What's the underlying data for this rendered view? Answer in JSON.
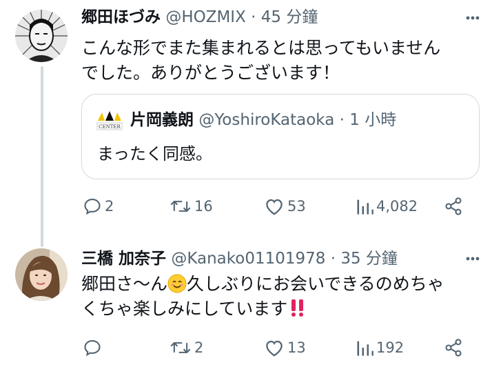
{
  "tweet1": {
    "name": "郷田ほづみ",
    "handle": "@HOZMIX",
    "time": " · 45 分鐘",
    "text_line1": "こんな形でまた集まれるとは思ってもいません",
    "text_line2": "でした。ありがとうございます！",
    "quote": {
      "name": "片岡義朗",
      "handle": "@YoshiroKataoka",
      "time": " · 1 小時",
      "avatar_text": "CENTER",
      "text": "まったく同感。"
    },
    "actions": {
      "replies": "2",
      "retweets": "16",
      "likes": "53",
      "views": "4,082"
    }
  },
  "tweet2": {
    "name": "三橋 加奈子",
    "handle": "@Kanako01101978",
    "time": " · 35 分鐘",
    "text_line1_a": "郷田さ〜ん",
    "emoji_1": "😊",
    "text_line1_b": "久しぶりにお会いできるのめちゃ",
    "text_line2": "くちゃ楽しみにしています",
    "emoji_2": "‼️",
    "actions": {
      "replies": "",
      "retweets": "2",
      "likes": "13",
      "views": "192"
    }
  },
  "icons": [
    "reply-icon",
    "retweet-icon",
    "like-icon",
    "views-icon",
    "share-icon",
    "more-icon"
  ],
  "colors": {
    "text": "#0f1419",
    "secondary": "#536471",
    "border": "#cfd9de",
    "emoji_red": "#e0245e"
  }
}
